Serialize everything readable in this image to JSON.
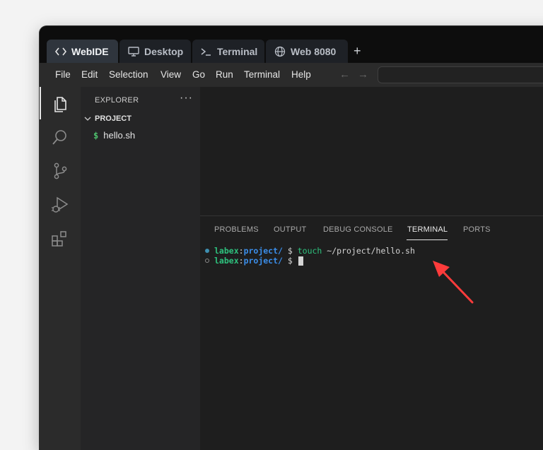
{
  "tabs": [
    {
      "label": "WebIDE",
      "icon": "code-icon",
      "active": true
    },
    {
      "label": "Desktop",
      "icon": "monitor-icon",
      "active": false
    },
    {
      "label": "Terminal",
      "icon": "terminal-prompt-icon",
      "active": false
    },
    {
      "label": "Web 8080",
      "icon": "globe-icon",
      "active": false
    }
  ],
  "tab_add": "+",
  "menu": [
    "File",
    "Edit",
    "Selection",
    "View",
    "Go",
    "Run",
    "Terminal",
    "Help"
  ],
  "nav": {
    "back": "←",
    "forward": "→"
  },
  "activity_bar": [
    "explorer-icon",
    "search-icon",
    "source-control-icon",
    "run-debug-icon",
    "extensions-icon"
  ],
  "explorer": {
    "title": "EXPLORER",
    "more": "···",
    "project": "PROJECT",
    "files": [
      {
        "name": "hello.sh",
        "icon": "$"
      }
    ]
  },
  "panel_tabs": [
    "PROBLEMS",
    "OUTPUT",
    "DEBUG CONSOLE",
    "TERMINAL",
    "PORTS"
  ],
  "active_panel_tab": "TERMINAL",
  "terminal": {
    "lines": [
      {
        "user": "labex",
        "sep": ":",
        "path": "project/",
        "prompt": " $ ",
        "cmd": "touch",
        "args": " ~/project/hello.sh",
        "status": "done"
      },
      {
        "user": "labex",
        "sep": ":",
        "path": "project/",
        "prompt": " $ ",
        "cmd": "",
        "args": "",
        "status": "idle"
      }
    ]
  },
  "colors": {
    "accent_arrow": "#ff3b3b",
    "terminal_user": "#2ec27e",
    "terminal_path": "#3b8eea"
  }
}
